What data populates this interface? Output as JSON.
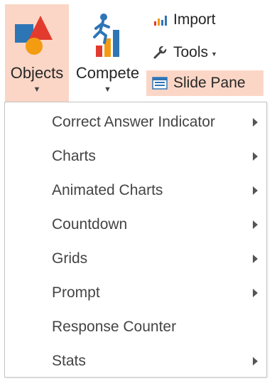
{
  "ribbon": {
    "objects": {
      "label": "Objects",
      "icon": "shapes-icon"
    },
    "compete": {
      "label": "Compete",
      "icon": "runner-chart-icon"
    },
    "import": {
      "label": "Import",
      "icon": "bar-chart-icon"
    },
    "tools": {
      "label": "Tools",
      "icon": "wrench-icon"
    },
    "slide_pane": {
      "label": "Slide Pane",
      "icon": "slide-pane-icon"
    },
    "accent": "#fbd6c6"
  },
  "menu": {
    "items": [
      {
        "label": "Correct Answer Indicator",
        "submenu": true
      },
      {
        "label": "Charts",
        "submenu": true
      },
      {
        "label": "Animated Charts",
        "submenu": true
      },
      {
        "label": "Countdown",
        "submenu": true
      },
      {
        "label": "Grids",
        "submenu": true
      },
      {
        "label": "Prompt",
        "submenu": true
      },
      {
        "label": "Response Counter",
        "submenu": false
      },
      {
        "label": "Stats",
        "submenu": true
      }
    ]
  }
}
